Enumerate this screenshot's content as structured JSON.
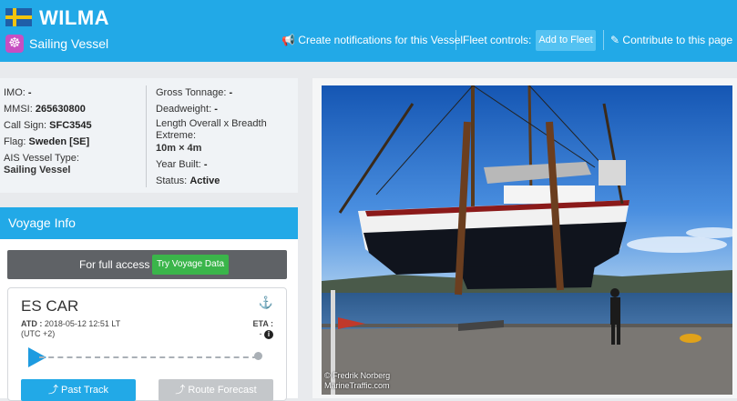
{
  "vessel": {
    "name": "WILMA",
    "type": "Sailing Vessel",
    "flag_icon": "sweden-flag-icon"
  },
  "header_actions": {
    "notifications": "Create notifications for this Vessel",
    "fleet_controls": "Fleet controls:",
    "add_to_fleet": "Add to Fleet",
    "contribute": "Contribute to this page"
  },
  "details": {
    "imo_label": "IMO:",
    "imo": "-",
    "mmsi_label": "MMSI:",
    "mmsi": "265630800",
    "callsign_label": "Call Sign:",
    "callsign": "SFC3545",
    "flag_label": "Flag:",
    "flag": "Sweden [SE]",
    "ais_type_label": "AIS Vessel Type:",
    "ais_type": "Sailing Vessel",
    "gross_tonnage_label": "Gross Tonnage:",
    "gross_tonnage": "-",
    "deadweight_label": "Deadweight:",
    "deadweight": "-",
    "length_label_1": "Length Overall x Breadth",
    "length_label_2": "Extreme:",
    "length": "10m × 4m",
    "year_built_label": "Year Built:",
    "year_built": "-",
    "status_label": "Status:",
    "status": "Active"
  },
  "voyage": {
    "heading": "Voyage Info",
    "full_access": "For full access",
    "try_button": "Try Voyage Data",
    "destination": "ES CAR",
    "atd_label": "ATD :",
    "atd_value": "2018-05-12 12:51 LT",
    "atd_tz": "(UTC +2)",
    "eta_label": "ETA :",
    "eta_value": "-",
    "past_track": "Past Track",
    "route_forecast": "Route Forecast"
  },
  "photo": {
    "credit": "© Fredrik Norberg",
    "site": "MarineTraffic.com"
  },
  "colors": {
    "brand_blue": "#22a9e7",
    "try_green": "#3ab54a",
    "type_purple": "#c74fc2"
  }
}
